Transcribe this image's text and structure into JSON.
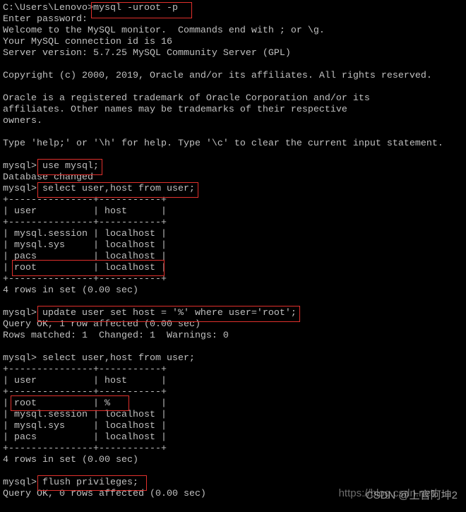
{
  "terminal": {
    "lines": [
      "C:\\Users\\Lenovo>mysql -uroot -p",
      "Enter password:",
      "Welcome to the MySQL monitor.  Commands end with ; or \\g.",
      "Your MySQL connection id is 16",
      "Server version: 5.7.25 MySQL Community Server (GPL)",
      "",
      "Copyright (c) 2000, 2019, Oracle and/or its affiliates. All rights reserved.",
      "",
      "Oracle is a registered trademark of Oracle Corporation and/or its",
      "affiliates. Other names may be trademarks of their respective",
      "owners.",
      "",
      "Type 'help;' or '\\h' for help. Type '\\c' to clear the current input statement.",
      "",
      "mysql> use mysql;",
      "Database changed",
      "mysql> select user,host from user;",
      "+---------------+-----------+",
      "| user          | host      |",
      "+---------------+-----------+",
      "| mysql.session | localhost |",
      "| mysql.sys     | localhost |",
      "| pacs          | localhost |",
      "| root          | localhost |",
      "+---------------+-----------+",
      "4 rows in set (0.00 sec)",
      "",
      "mysql> update user set host = '%' where user='root';",
      "Query OK, 1 row affected (0.00 sec)",
      "Rows matched: 1  Changed: 1  Warnings: 0",
      "",
      "mysql> select user,host from user;",
      "+---------------+-----------+",
      "| user          | host      |",
      "+---------------+-----------+",
      "| root          | %         |",
      "| mysql.session | localhost |",
      "| mysql.sys     | localhost |",
      "| pacs          | localhost |",
      "+---------------+-----------+",
      "4 rows in set (0.00 sec)",
      "",
      "mysql> flush privileges;",
      "Query OK, 0 rows affected (0.00 sec)"
    ]
  },
  "colors": {
    "background": "#000000",
    "text": "#c0c0c0",
    "highlight": "#e0302c"
  },
  "watermark": {
    "url": "https://blog.csdn.net/",
    "text": "CSDN @上官阿坤2"
  }
}
